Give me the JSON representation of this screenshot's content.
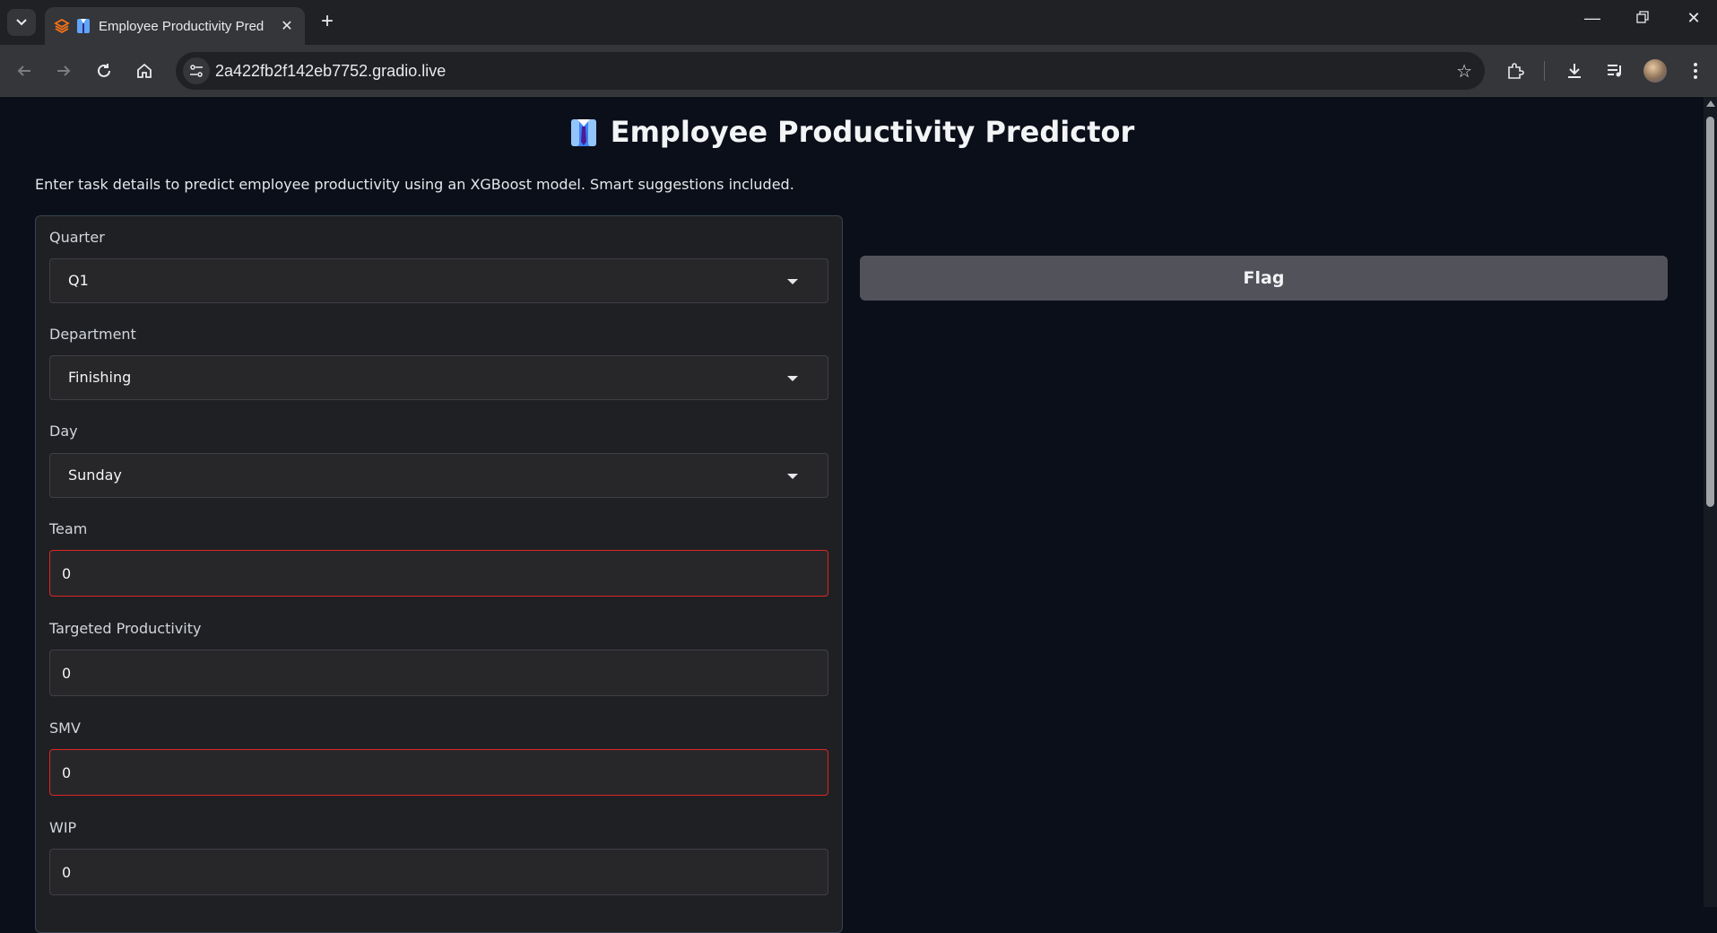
{
  "browser": {
    "tab_title": "Employee Productivity Pred",
    "url": "2a422fb2f142eb7752.gradio.live",
    "icons": [
      "tab-list-icon",
      "gradio-logo-icon",
      "page-favicon-icon",
      "close-icon",
      "new-tab-icon",
      "minimize-icon",
      "restore-icon",
      "window-close-icon",
      "back-icon",
      "forward-icon",
      "reload-icon",
      "home-icon",
      "site-info-icon",
      "bookmark-star-icon",
      "extensions-icon",
      "download-icon",
      "media-controls-icon",
      "profile-avatar",
      "menu-kebab-icon"
    ]
  },
  "app": {
    "title": "Employee Productivity Predictor",
    "title_icon": "necktie-shirt-emoji",
    "description": "Enter task details to predict employee productivity using an XGBoost model. Smart suggestions included."
  },
  "form": {
    "quarter": {
      "label": "Quarter",
      "value": "Q1"
    },
    "department": {
      "label": "Department",
      "value": "Finishing"
    },
    "day": {
      "label": "Day",
      "value": "Sunday"
    },
    "team": {
      "label": "Team",
      "value": "0"
    },
    "targeted_productivity": {
      "label": "Targeted Productivity",
      "value": "0"
    },
    "smv": {
      "label": "SMV",
      "value": "0"
    },
    "wip": {
      "label": "WIP",
      "value": "0"
    }
  },
  "actions": {
    "flag_label": "Flag"
  },
  "colors": {
    "page_bg": "#0b0f19",
    "panel_bg": "#1f2023",
    "input_bg": "#27272a",
    "error_border": "#dc2626",
    "flag_button_bg": "#52525b"
  }
}
